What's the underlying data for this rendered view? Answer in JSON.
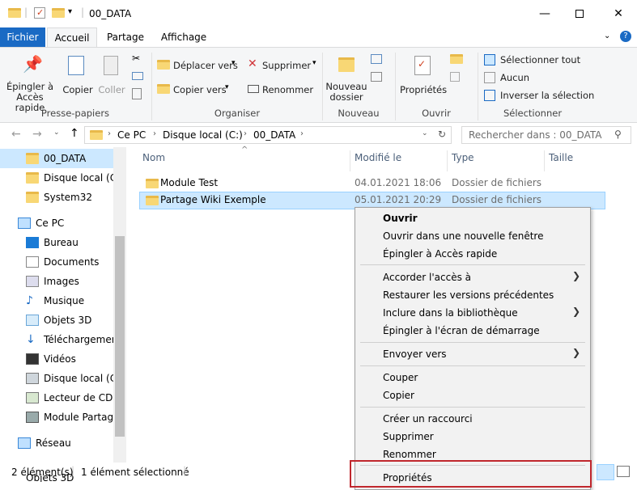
{
  "window": {
    "title": "00_DATA",
    "minimize_icon": "minimize-icon",
    "maximize_icon": "maximize-icon",
    "close_icon": "close-icon",
    "help_label": "?"
  },
  "tabs": [
    "Fichier",
    "Accueil",
    "Partage",
    "Affichage"
  ],
  "ribbon": {
    "pin": "Épingler à\nAccès rapide",
    "copy": "Copier",
    "paste": "Coller",
    "presse_papiers": "Presse-papiers",
    "move_to": "Déplacer vers",
    "copy_to": "Copier vers",
    "delete": "Supprimer",
    "rename": "Renommer",
    "organiser": "Organiser",
    "new_folder": "Nouveau\ndossier",
    "nouveau": "Nouveau",
    "properties": "Propriétés",
    "ouvrir": "Ouvrir",
    "select_all": "Sélectionner tout",
    "select_none": "Aucun",
    "invert": "Inverser la sélection",
    "selectionner": "Sélectionner"
  },
  "address": {
    "crumbs": [
      "Ce PC",
      "Disque local (C:)",
      "00_DATA"
    ],
    "search_placeholder": "Rechercher dans : 00_DATA"
  },
  "nav": [
    {
      "label": "00_DATA",
      "icon": "folder-icon",
      "selected": true
    },
    {
      "label": "Disque local (C:)",
      "icon": "folder-icon"
    },
    {
      "label": "System32",
      "icon": "folder-icon"
    },
    {
      "label": "Ce PC",
      "icon": "pc-icon"
    },
    {
      "label": "Bureau",
      "icon": "desktop-icon"
    },
    {
      "label": "Documents",
      "icon": "documents-icon"
    },
    {
      "label": "Images",
      "icon": "images-icon"
    },
    {
      "label": "Musique",
      "icon": "music-icon"
    },
    {
      "label": "Objets 3D",
      "icon": "objects3d-icon"
    },
    {
      "label": "Téléchargement",
      "icon": "download-icon"
    },
    {
      "label": "Vidéos",
      "icon": "videos-icon"
    },
    {
      "label": "Disque local (C:)",
      "icon": "drive-icon"
    },
    {
      "label": "Lecteur de CD (D",
      "icon": "cd-drive-icon"
    },
    {
      "label": "Module Partage",
      "icon": "network-drive-icon"
    },
    {
      "label": "Réseau",
      "icon": "network-icon"
    },
    {
      "label": "Objets 3D",
      "icon": "objects3d-icon"
    }
  ],
  "columns": [
    "Nom",
    "Modifié le",
    "Type",
    "Taille"
  ],
  "files": [
    {
      "name": "Module Test",
      "modified": "04.01.2021 18:06",
      "type": "Dossier de fichiers"
    },
    {
      "name": "Partage Wiki Exemple",
      "modified": "05.01.2021 20:29",
      "type": "Dossier de fichiers"
    }
  ],
  "context_menu": {
    "open": "Ouvrir",
    "open_new_window": "Ouvrir dans une nouvelle fenêtre",
    "pin_quick": "Épingler à Accès rapide",
    "give_access": "Accorder l'accès à",
    "restore_versions": "Restaurer les versions précédentes",
    "include_library": "Inclure dans la bibliothèque",
    "pin_start": "Épingler à l'écran de démarrage",
    "send_to": "Envoyer vers",
    "cut": "Couper",
    "copy": "Copier",
    "create_shortcut": "Créer un raccourci",
    "delete": "Supprimer",
    "rename": "Renommer",
    "properties": "Propriétés"
  },
  "status": {
    "count": "2 élément(s)",
    "selected": "1 élément sélectionné"
  },
  "colors": {
    "accent": "#1a6ac4",
    "selection": "#cce8ff",
    "highlight_box": "#c0272d"
  }
}
